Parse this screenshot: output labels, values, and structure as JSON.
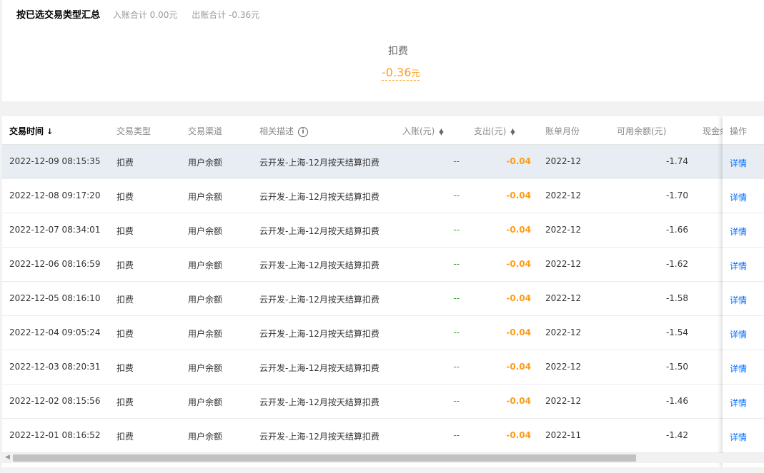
{
  "summary": {
    "title": "按已选交易类型汇总",
    "income_total": "入账合计 0.00元",
    "expense_total": "出账合计 -0.36元",
    "type_label": "扣费",
    "type_amount": "-0.36",
    "type_unit": "元"
  },
  "table": {
    "columns": {
      "time": "交易时间",
      "type": "交易类型",
      "channel": "交易渠道",
      "desc": "相关描述",
      "income": "入账(元)",
      "expense": "支出(元)",
      "month": "账单月份",
      "balance": "可用余额(元)",
      "cash": "现金余",
      "op": "操作"
    },
    "sort_arrow": "↓",
    "info_icon": "i",
    "detail_label": "详情",
    "rows": [
      {
        "time": "2022-12-09 08:15:35",
        "type": "扣费",
        "channel": "用户余额",
        "desc": "云开发-上海-12月按天结算扣费",
        "income": "--",
        "expense": "-0.04",
        "month": "2022-12",
        "balance": "-1.74"
      },
      {
        "time": "2022-12-08 09:17:20",
        "type": "扣费",
        "channel": "用户余额",
        "desc": "云开发-上海-12月按天结算扣费",
        "income": "--",
        "expense": "-0.04",
        "month": "2022-12",
        "balance": "-1.70"
      },
      {
        "time": "2022-12-07 08:34:01",
        "type": "扣费",
        "channel": "用户余额",
        "desc": "云开发-上海-12月按天结算扣费",
        "income": "--",
        "expense": "-0.04",
        "month": "2022-12",
        "balance": "-1.66"
      },
      {
        "time": "2022-12-06 08:16:59",
        "type": "扣费",
        "channel": "用户余额",
        "desc": "云开发-上海-12月按天结算扣费",
        "income": "--",
        "expense": "-0.04",
        "month": "2022-12",
        "balance": "-1.62"
      },
      {
        "time": "2022-12-05 08:16:10",
        "type": "扣费",
        "channel": "用户余额",
        "desc": "云开发-上海-12月按天结算扣费",
        "income": "--",
        "expense": "-0.04",
        "month": "2022-12",
        "balance": "-1.58"
      },
      {
        "time": "2022-12-04 09:05:24",
        "type": "扣费",
        "channel": "用户余额",
        "desc": "云开发-上海-12月按天结算扣费",
        "income": "--",
        "expense": "-0.04",
        "month": "2022-12",
        "balance": "-1.54"
      },
      {
        "time": "2022-12-03 08:20:31",
        "type": "扣费",
        "channel": "用户余额",
        "desc": "云开发-上海-12月按天结算扣费",
        "income": "--",
        "expense": "-0.04",
        "month": "2022-12",
        "balance": "-1.50"
      },
      {
        "time": "2022-12-02 08:15:56",
        "type": "扣费",
        "channel": "用户余额",
        "desc": "云开发-上海-12月按天结算扣费",
        "income": "--",
        "expense": "-0.04",
        "month": "2022-12",
        "balance": "-1.46"
      },
      {
        "time": "2022-12-01 08:16:52",
        "type": "扣费",
        "channel": "用户余额",
        "desc": "云开发-上海-12月按天结算扣费",
        "income": "--",
        "expense": "-0.04",
        "month": "2022-11",
        "balance": "-1.42"
      }
    ]
  },
  "colors": {
    "accent_orange": "#ff9c19",
    "link_blue": "#006eff",
    "dash_green": "#2ea121",
    "row_highlight": "#e8edf4"
  },
  "icons": [
    "sort-desc-icon",
    "info-icon",
    "sort-toggle-icon",
    "scroll-left-arrow-icon"
  ]
}
